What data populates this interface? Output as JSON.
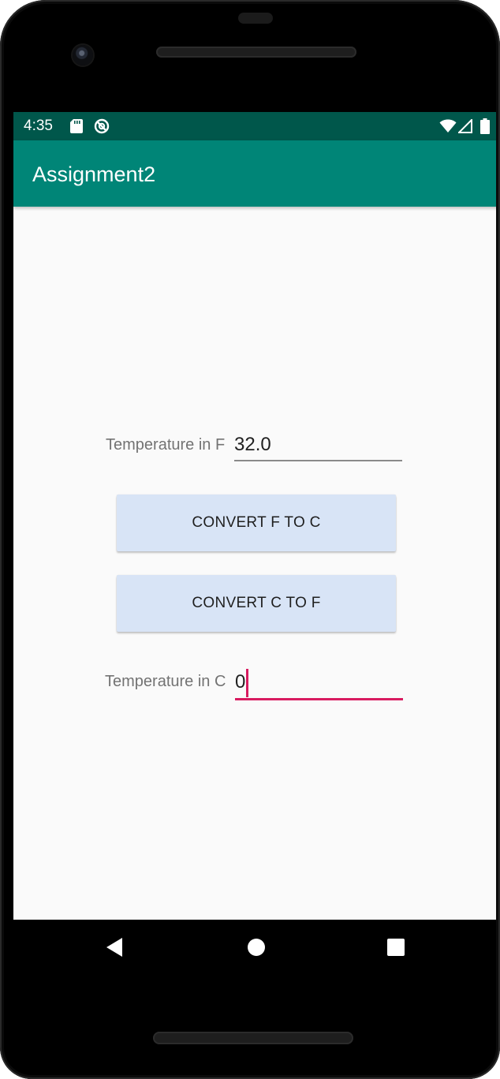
{
  "status_bar": {
    "time": "4:35",
    "icons": [
      "sd-card-icon",
      "no-sync-icon",
      "wifi-icon",
      "cell-signal-icon",
      "battery-icon"
    ]
  },
  "app_bar": {
    "title": "Assignment2"
  },
  "fahrenheit": {
    "label": "Temperature in F",
    "value": "32.0"
  },
  "buttons": {
    "f_to_c": "CONVERT F TO C",
    "c_to_f": "CONVERT C TO F"
  },
  "celsius": {
    "label": "Temperature in C",
    "value": "0"
  },
  "nav": {
    "icons": [
      "back-icon",
      "home-icon",
      "recents-icon"
    ]
  },
  "colors": {
    "status_bar": "#00574b",
    "app_bar": "#008577",
    "accent": "#d81b60",
    "button_bg": "#d8e4f6"
  }
}
